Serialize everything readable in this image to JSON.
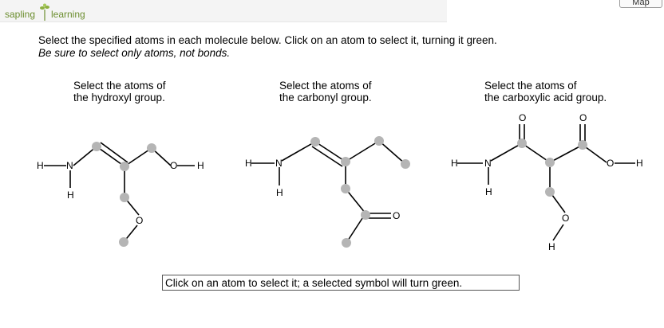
{
  "header": {
    "logo": {
      "word1": "sapling",
      "word2": "learning"
    },
    "map_button": "Map"
  },
  "instructions": {
    "line1": "Select the specified atoms in each molecule below. Click on an atom to select it, turning it green.",
    "line2": "Be sure to select only atoms, not bonds."
  },
  "molecules": [
    {
      "heading_line1": "Select the atoms of",
      "heading_line2": "the hydroxyl group."
    },
    {
      "heading_line1": "Select the atoms of",
      "heading_line2": "the carbonyl group."
    },
    {
      "heading_line1": "Select the atoms of",
      "heading_line2": "the carboxylic acid group."
    }
  ],
  "atom_symbols": {
    "hydrogen": "H",
    "nitrogen": "N",
    "oxygen": "O"
  },
  "status_text": "Click on an atom to select it; a selected symbol will turn green.",
  "colors": {
    "atom_highlight": "#b5b5b5",
    "logo_green": "#6c8e2f",
    "bond": "#000000"
  }
}
